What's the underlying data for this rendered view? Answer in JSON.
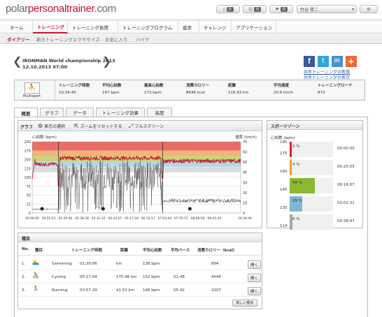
{
  "header": {
    "logo_main": "polar",
    "logo_accent": "personaltrainer",
    "logo_suffix": ".com",
    "count1": "0",
    "count2": "0",
    "count3": "0",
    "user": "竹谷 賢二"
  },
  "nav": [
    "ホーム",
    "トレーニング",
    "トレーニング負荷",
    "トレーニングプログラム",
    "進歩",
    "チャレンジ",
    "アプリケーション"
  ],
  "subnav": [
    "ダイアリー",
    "新カトレーニングエクササイズ",
    "お気に入り",
    "バイク"
  ],
  "session": {
    "title": "IRONMAN World championship 2013",
    "datetime": "12.10.2013 07:00",
    "sport": "Multisport"
  },
  "share": {
    "link1": "共有トレーニングの新規",
    "link2": "共有トレーニングの表示"
  },
  "stats": [
    {
      "label": "トレーニング時間",
      "value": "10:34:40"
    },
    {
      "label": "平均心拍数",
      "value": "147  bpm"
    },
    {
      "label": "最高心拍数",
      "value": "173  bpm"
    },
    {
      "label": "消費カロリー",
      "value": "8646  kcal"
    },
    {
      "label": "距離",
      "value": "216.93  km"
    },
    {
      "label": "平均速度",
      "value": "20.6  km/h"
    },
    {
      "label": "トレーニングロード",
      "value": "872"
    }
  ],
  "tabs": [
    "概要",
    "グラフ",
    "データ",
    "トレーニング効果",
    "高度"
  ],
  "chart_toolbar": {
    "graph": "グラフ",
    "show": "表示の選択",
    "zoom": "ズームをリセットする",
    "full": "フルスクリーン"
  },
  "chart_data": {
    "type": "line",
    "ylabel": "心拍数 (bpm)",
    "y2label": "速度 (km/h)",
    "yticks": [
      "200",
      "175",
      "150",
      "125",
      "100",
      "75",
      "50",
      "25",
      "0"
    ],
    "y2ticks": [
      "70",
      "60",
      "50",
      "40",
      "30",
      "20",
      "10",
      "0"
    ],
    "xticks": [
      "00:00:00",
      "00:52:53",
      "01:45:46",
      "02:38:39",
      "03:31:32",
      "04:24:25",
      "05:17:18",
      "06:10:11",
      "07:03:04",
      "07:55:57",
      "08:48:50",
      "09:41:43",
      "10:34:40"
    ],
    "ylim": [
      0,
      200
    ],
    "y2lim": [
      0,
      70
    ],
    "xlim": [
      0,
      10.578
    ]
  },
  "laps": {
    "title": "種目",
    "headers": [
      "No.",
      "種目",
      "トレーニング時間",
      "距離",
      "平均心拍数",
      "平均ペース",
      "消費カロリー（kcal）"
    ],
    "rows": [
      {
        "no": "1.",
        "sport": "Swimming",
        "time": "01:20:06",
        "dist": "km",
        "hr": "138 bpm",
        "pace": "",
        "kcal": "894",
        "btn": "開く"
      },
      {
        "no": "2.",
        "sport": "Cycling",
        "time": "05:17:04",
        "dist": "175.48 km",
        "hr": "152 bpm",
        "pace": "01:48",
        "kcal": "4545",
        "btn": "開く"
      },
      {
        "no": "3.",
        "sport": "Running",
        "time": "03:57:29",
        "dist": "41.53 km",
        "hr": "146 bpm",
        "pace": "05:42",
        "kcal": "3207",
        "btn": "開く"
      }
    ],
    "new_btn": "新しい種目"
  },
  "zones": {
    "title": "スポーツゾーン",
    "hr_label": "心拍数 (bpm)",
    "rows": [
      {
        "top": "190",
        "bottom": "175",
        "pct": "0 %",
        "time": "00:00:00",
        "fraction": 0.0,
        "color": "#e02020"
      },
      {
        "top": "",
        "bottom": "160",
        "pct": "4 %",
        "time": "00:25:05",
        "fraction": 0.04,
        "color": "#f0a020"
      },
      {
        "top": "",
        "bottom": "145",
        "pct": "58 %",
        "time": "06:16:07",
        "fraction": 0.58,
        "color": "#8ab832"
      },
      {
        "top": "",
        "bottom": "130",
        "pct": "29 %",
        "time": "03:02:31",
        "fraction": 0.29,
        "color": "#7fb6d6"
      },
      {
        "top": "",
        "bottom": "114",
        "pct": "6 %",
        "time": "00:39:47",
        "fraction": 0.06,
        "color": "#a8a8a8"
      }
    ]
  }
}
